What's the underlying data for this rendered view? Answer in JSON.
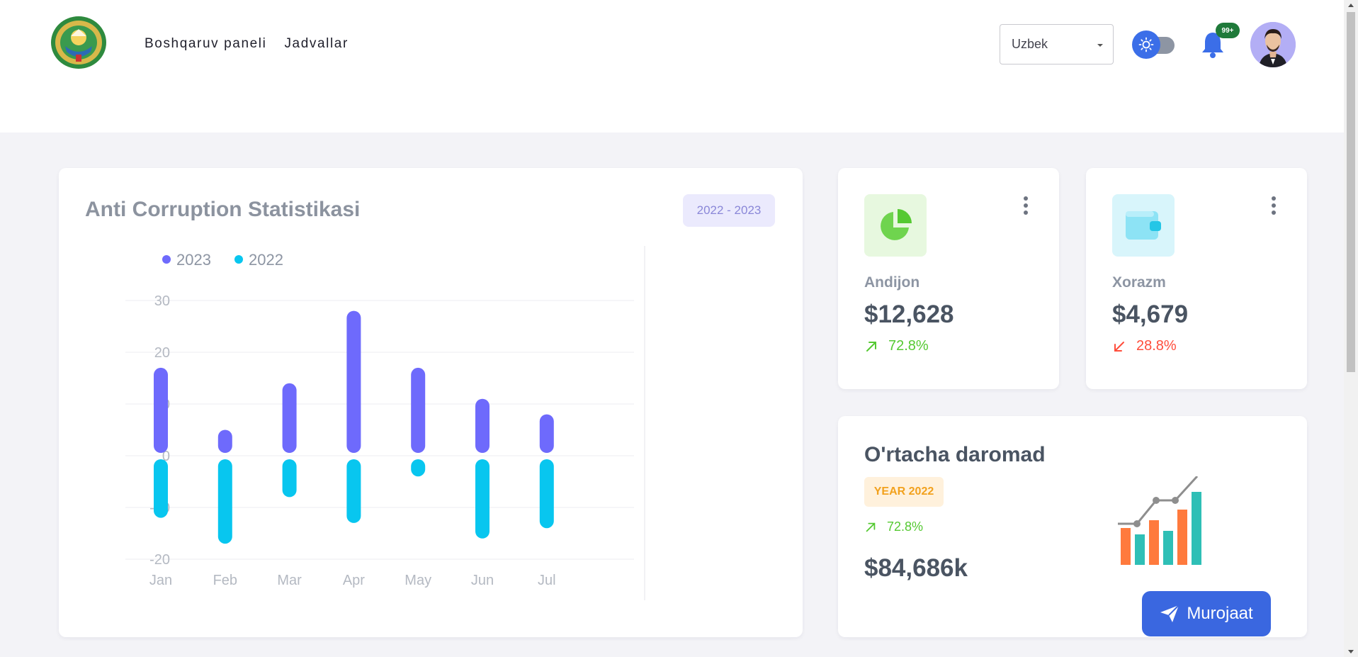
{
  "header": {
    "nav": [
      "Boshqaruv paneli",
      "Jadvallar"
    ],
    "language": "Uzbek",
    "notifications_badge": "99+"
  },
  "chart_card": {
    "title": "Anti Corruption Statistikasi",
    "year_range": "2022 - 2023"
  },
  "chart_data": {
    "type": "bar",
    "categories": [
      "Jan",
      "Feb",
      "Mar",
      "Apr",
      "May",
      "Jun",
      "Jul"
    ],
    "series": [
      {
        "name": "2023",
        "values": [
          17,
          5,
          14,
          28,
          17,
          11,
          8
        ],
        "color": "#6e6afc"
      },
      {
        "name": "2022",
        "values": [
          -12,
          -17,
          -8,
          -13,
          -4,
          -16,
          -14
        ],
        "color": "#08c6ef"
      }
    ],
    "y_ticks": [
      30,
      20,
      10,
      0,
      -10,
      -20
    ],
    "ylim": [
      -20,
      30
    ],
    "legend": "top-left",
    "grid": true
  },
  "stats": [
    {
      "name": "Andijon",
      "value": "$12,628",
      "change": "72.8%",
      "direction": "up",
      "icon": "pie-chart-icon",
      "color": "#55c932",
      "bg": "#e7f8df"
    },
    {
      "name": "Xorazm",
      "value": "$4,679",
      "change": "28.8%",
      "direction": "down",
      "icon": "wallet-icon",
      "color": "#ff4d3b",
      "bg": "#d8f5fb"
    }
  ],
  "income": {
    "title": "O'rtacha daromad",
    "year_label": "YEAR 2022",
    "change": "72.8%",
    "value": "$84,686k"
  },
  "fab": {
    "label": "Murojaat"
  }
}
